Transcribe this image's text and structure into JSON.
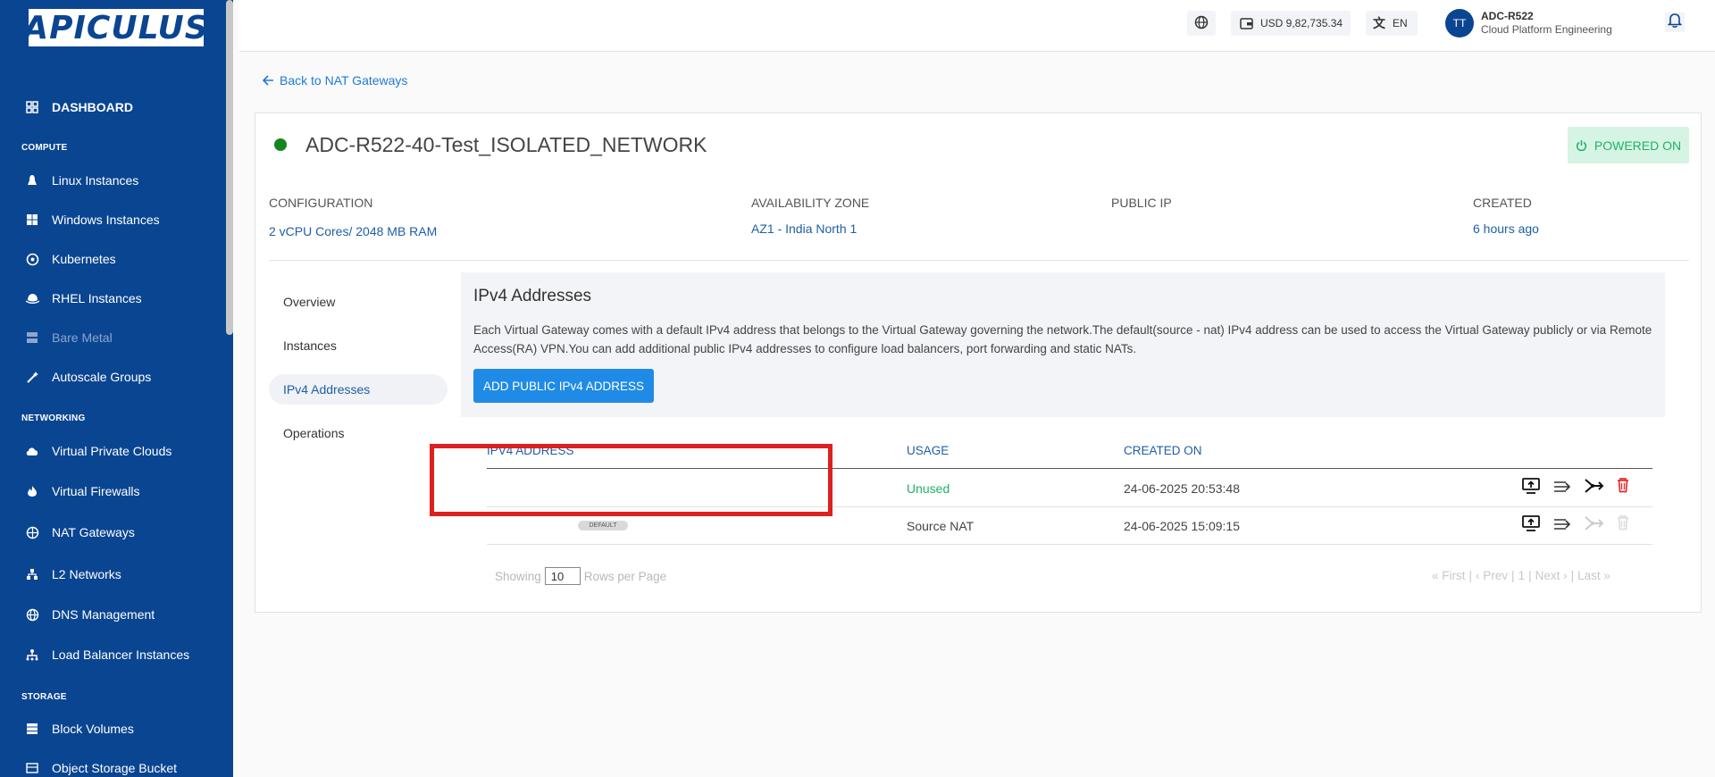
{
  "sidebar": {
    "logo": "APICULUS",
    "dashboard": "DASHBOARD",
    "sections": {
      "compute": "COMPUTE",
      "networking": "NETWORKING",
      "storage": "STORAGE"
    },
    "compute_items": [
      "Linux Instances",
      "Windows Instances",
      "Kubernetes",
      "RHEL Instances",
      "Bare Metal",
      "Autoscale Groups"
    ],
    "networking_items": [
      "Virtual Private Clouds",
      "Virtual Firewalls",
      "NAT Gateways",
      "L2 Networks",
      "DNS Management",
      "Load Balancer Instances"
    ],
    "storage_items": [
      "Block Volumes",
      "Object Storage Bucket"
    ]
  },
  "header": {
    "balance": "USD 9,82,735.34",
    "language": "EN",
    "avatar_initials": "TT",
    "user_name": "ADC-R522",
    "user_org": "Cloud Platform Engineering"
  },
  "back_link": "Back to NAT Gateways",
  "gateway": {
    "name": "ADC-R522-40-Test_ISOLATED_NETWORK",
    "status": "POWERED ON",
    "meta": {
      "configuration_label": "CONFIGURATION",
      "configuration_value": "2 vCPU Cores/ 2048 MB RAM",
      "zone_label": "AVAILABILITY ZONE",
      "zone_value": "AZ1 - India North 1",
      "public_ip_label": "PUBLIC IP",
      "created_label": "CREATED",
      "created_value": "6 hours ago"
    }
  },
  "tabs": [
    "Overview",
    "Instances",
    "IPv4 Addresses",
    "Operations"
  ],
  "active_tab": "IPv4 Addresses",
  "ipv4": {
    "title": "IPv4 Addresses",
    "description": "Each Virtual Gateway comes with a default IPv4 address that belongs to the Virtual Gateway governing the network.The default(source - nat) IPv4 address can be used to access the Virtual Gateway publicly or via Remote Access(RA) VPN.You can add additional public IPv4 addresses to configure load balancers, port forwarding and static NATs.",
    "add_button": "ADD PUBLIC IPv4 ADDRESS",
    "columns": [
      "IPV4 ADDRESS",
      "USAGE",
      "CREATED ON"
    ],
    "rows": [
      {
        "ip": "",
        "usage": "Unused",
        "created": "24-06-2025 20:53:48"
      },
      {
        "ip": "",
        "badge": "DEFAULT",
        "usage": "Source NAT",
        "created": "24-06-2025 15:09:15"
      }
    ],
    "pager": {
      "showing": "Showing",
      "rows_per_page_value": "10",
      "rows_per_page": "Rows per Page",
      "first": "« First",
      "prev": "‹ Prev",
      "page": "1",
      "next": "Next ›",
      "last": "Last »",
      "sep": "|"
    }
  },
  "colors": {
    "sidebar": "#0a4591",
    "accent": "#1f8be6",
    "success": "#20b06a",
    "danger": "#dd2020"
  }
}
